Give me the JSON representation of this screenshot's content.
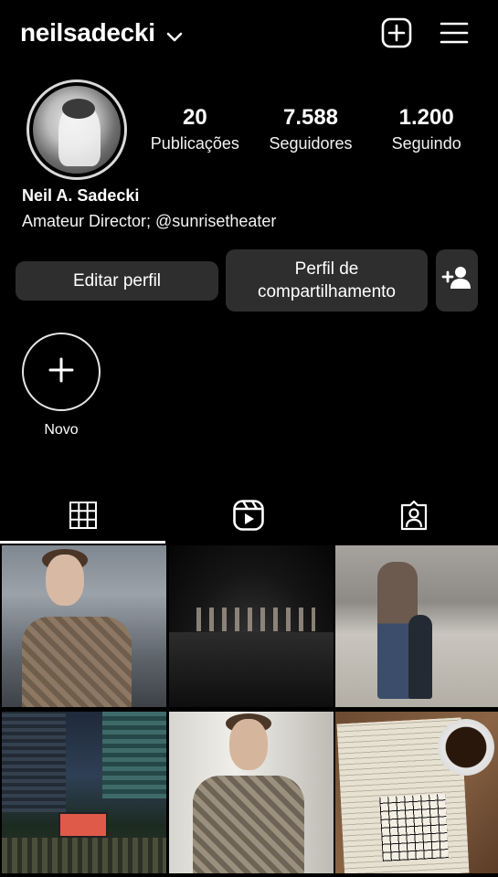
{
  "header": {
    "username": "neilsadecki",
    "icons": {
      "dropdown": "chevron-down-icon",
      "create": "plus-square-icon",
      "menu": "hamburger-menu-icon"
    }
  },
  "profile": {
    "avatar_icon": "profile-avatar",
    "stats": [
      {
        "value": "20",
        "label": "Publicações"
      },
      {
        "value": "7.588",
        "label": "Seguidores"
      },
      {
        "value": "1.200",
        "label": "Seguindo"
      }
    ],
    "name": "Neil A. Sadecki",
    "bio": "Amateur Director; @sunrisetheater"
  },
  "actions": {
    "edit_label": "Editar perfil",
    "share_label": "Perfil de compartilhamento",
    "add_user_icon": "add-person-icon"
  },
  "highlights": {
    "new_label": "Novo"
  },
  "tabs": [
    {
      "icon": "grid-icon",
      "active": true
    },
    {
      "icon": "reels-icon",
      "active": false
    },
    {
      "icon": "tagged-icon",
      "active": false
    }
  ],
  "posts": [
    {
      "icon": "elevator-selfie-photo"
    },
    {
      "icon": "theater-stage-photo"
    },
    {
      "icon": "beach-photo"
    },
    {
      "icon": "outdoor-movie-photo"
    },
    {
      "icon": "mirror-selfie-photo"
    },
    {
      "icon": "crossword-coffee-photo"
    }
  ]
}
